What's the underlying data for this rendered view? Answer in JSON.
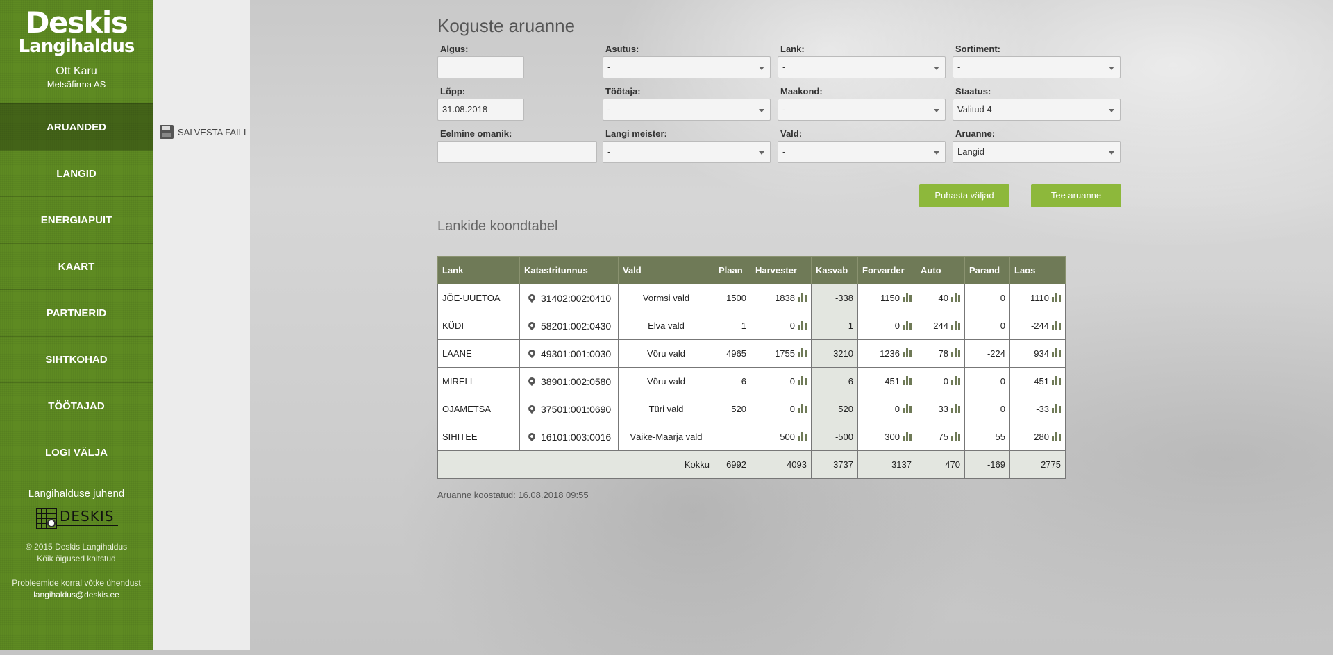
{
  "sidebar": {
    "logo_line1": "Deskis",
    "logo_line2": "Langihaldus",
    "user_name": "Ott Karu",
    "user_company": "Metsäfirma AS",
    "nav": [
      "ARUANDED",
      "LANGID",
      "ENERGIAPUIT",
      "KAART",
      "PARTNERID",
      "SIHTKOHAD",
      "TÖÖTAJAD",
      "LOGI VÄLJA"
    ],
    "active": "ARUANDED",
    "guide": "Langihalduse juhend",
    "deskis_logo_text": "DESKIS",
    "copyright": "© 2015 Deskis Langihaldus",
    "rights": "Kõik õigused kaitstud",
    "contact": "Probleemide korral võtke ühendust",
    "email": "langihaldus@deskis.ee"
  },
  "toolbar": {
    "save_label": "SALVESTA FAILI"
  },
  "page": {
    "title": "Koguste aruanne"
  },
  "filters": {
    "algus": {
      "label": "Algus:",
      "value": ""
    },
    "asutus": {
      "label": "Asutus:",
      "value": "-"
    },
    "lank": {
      "label": "Lank:",
      "value": "-"
    },
    "sortiment": {
      "label": "Sortiment:",
      "value": "-"
    },
    "lopp": {
      "label": "Lõpp:",
      "value": "31.08.2018"
    },
    "tootaja": {
      "label": "Töötaja:",
      "value": "-"
    },
    "maakond": {
      "label": "Maakond:",
      "value": "-"
    },
    "staatus": {
      "label": "Staatus:",
      "value": "Valitud 4"
    },
    "eelmine": {
      "label": "Eelmine omanik:",
      "value": ""
    },
    "meister": {
      "label": "Langi meister:",
      "value": "-"
    },
    "vald": {
      "label": "Vald:",
      "value": "-"
    },
    "aruanne": {
      "label": "Aruanne:",
      "value": "Langid"
    }
  },
  "buttons": {
    "clear": "Puhasta väljad",
    "make": "Tee aruanne"
  },
  "table": {
    "title": "Lankide koondtabel",
    "headers": [
      "Lank",
      "Katastritunnus",
      "Vald",
      "Plaan",
      "Harvester",
      "Kasvab",
      "Forvarder",
      "Auto",
      "Parand",
      "Laos"
    ],
    "rows": [
      [
        "JÕE-UUETOA",
        "31402:002:0410",
        "Vormsi vald",
        "1500",
        "1838",
        "-338",
        "1150",
        "40",
        "0",
        "1110"
      ],
      [
        "KÜDI",
        "58201:002:0430",
        "Elva vald",
        "1",
        "0",
        "1",
        "0",
        "244",
        "0",
        "-244"
      ],
      [
        "LAANE",
        "49301:001:0030",
        "Võru vald",
        "4965",
        "1755",
        "3210",
        "1236",
        "78",
        "-224",
        "934"
      ],
      [
        "MIRELI",
        "38901:002:0580",
        "Võru vald",
        "6",
        "0",
        "6",
        "451",
        "0",
        "0",
        "451"
      ],
      [
        "OJAMETSA",
        "37501:001:0690",
        "Türi vald",
        "520",
        "0",
        "520",
        "0",
        "33",
        "0",
        "-33"
      ],
      [
        "SIHITEE",
        "16101:003:0016",
        "Väike-Maarja vald",
        "",
        "500",
        "-500",
        "300",
        "75",
        "55",
        "280"
      ]
    ],
    "total_label": "Kokku",
    "totals": [
      "6992",
      "4093",
      "3737",
      "3137",
      "470",
      "-169",
      "2775"
    ]
  },
  "created": "Aruanne koostatud: 16.08.2018 09:55"
}
